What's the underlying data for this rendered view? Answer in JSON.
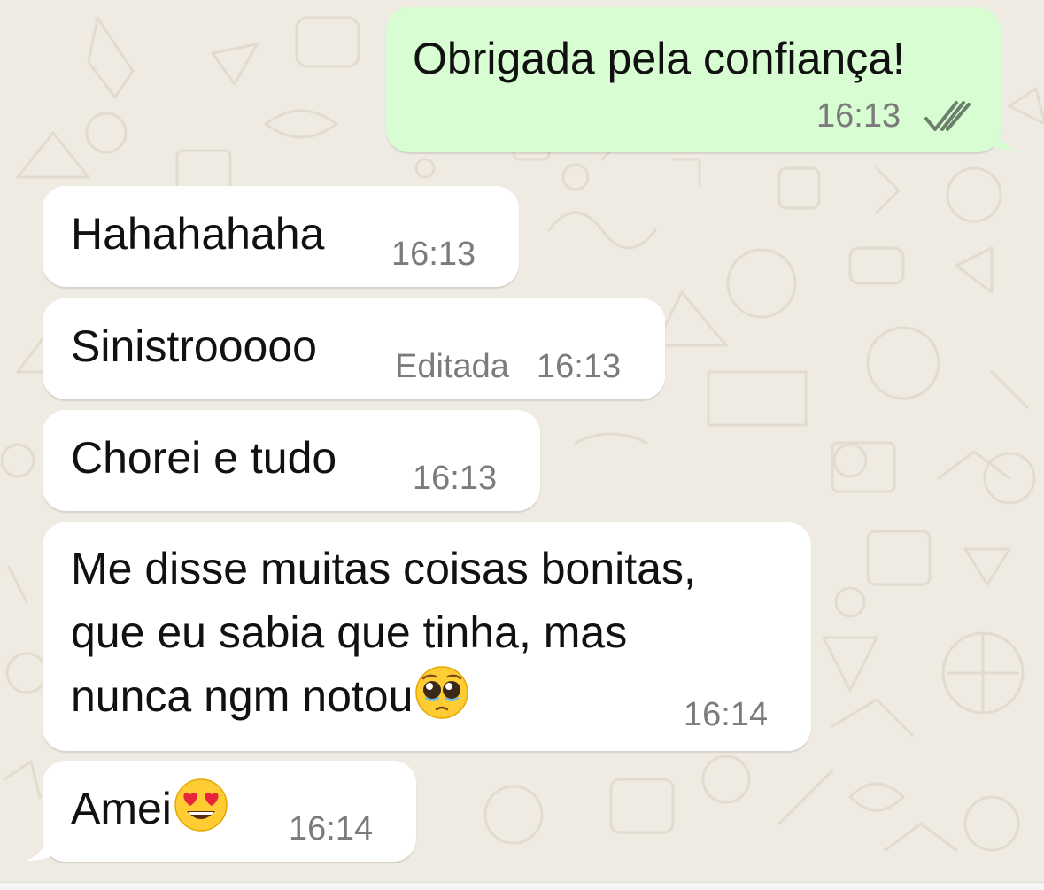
{
  "chat": {
    "messages": [
      {
        "direction": "outgoing",
        "text": "Obrigada pela confiança!",
        "time": "16:13",
        "status_icon": "double-check-icon"
      },
      {
        "direction": "incoming",
        "text": "Hahahahaha",
        "time": "16:13"
      },
      {
        "direction": "incoming",
        "text": "Sinistrooooo",
        "edited_label": "Editada",
        "time": "16:13"
      },
      {
        "direction": "incoming",
        "text": "Chorei e tudo",
        "time": "16:13"
      },
      {
        "direction": "incoming",
        "lines": [
          "Me disse muitas coisas bonitas,",
          "que eu sabia que tinha, mas",
          "nunca ngm notou"
        ],
        "emoji": "pleading-face-emoji",
        "time": "16:14"
      },
      {
        "direction": "incoming",
        "text": "Amei",
        "emoji": "heart-eyes-emoji",
        "time": "16:14"
      }
    ]
  },
  "colors": {
    "background": "#efeae2",
    "incoming_bubble": "#ffffff",
    "outgoing_bubble": "#d9fdd3",
    "text": "#111111",
    "meta_text": "#7b7b7b"
  }
}
